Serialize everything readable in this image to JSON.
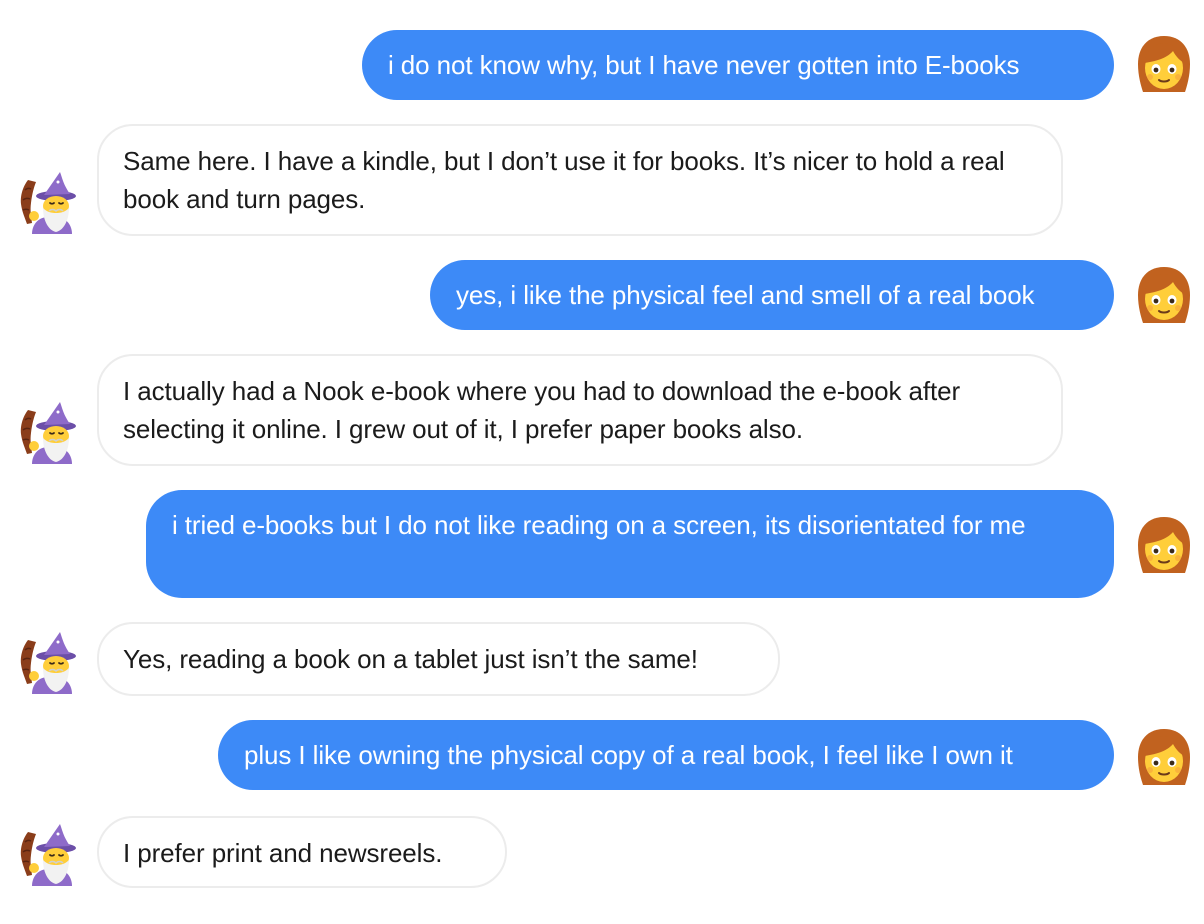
{
  "conversation": {
    "messages": [
      {
        "sender": "user",
        "text": "i do not know why, but I have never gotten into E-books",
        "avatar": "woman-red-hair-icon"
      },
      {
        "sender": "bot",
        "text": "Same here. I have a kindle, but I don’t use it for books. It’s nicer to hold a real book and turn pages.",
        "avatar": "wizard-icon"
      },
      {
        "sender": "user",
        "text": "yes, i like the physical feel and smell of a real book",
        "avatar": "woman-red-hair-icon"
      },
      {
        "sender": "bot",
        "text": "I actually had a Nook e-book where you had to download the e-book after selecting it online. I grew out of it, I prefer paper books also.",
        "avatar": "wizard-icon"
      },
      {
        "sender": "user",
        "text": "i tried e-books but I do not like reading on a screen, its disorientated for me",
        "avatar": "woman-red-hair-icon"
      },
      {
        "sender": "bot",
        "text": "Yes, reading a book on a tablet just isn’t the same!",
        "avatar": "wizard-icon"
      },
      {
        "sender": "user",
        "text": "plus I like owning the physical copy of a real book, I feel like I own it",
        "avatar": "woman-red-hair-icon"
      },
      {
        "sender": "bot",
        "text": "I prefer print and newsreels.",
        "avatar": "wizard-icon"
      }
    ]
  },
  "colors": {
    "user_bubble": "#3d8af7",
    "user_text": "#ffffff",
    "bot_bubble_border": "#ececec",
    "bot_text": "#1b1b1b"
  }
}
